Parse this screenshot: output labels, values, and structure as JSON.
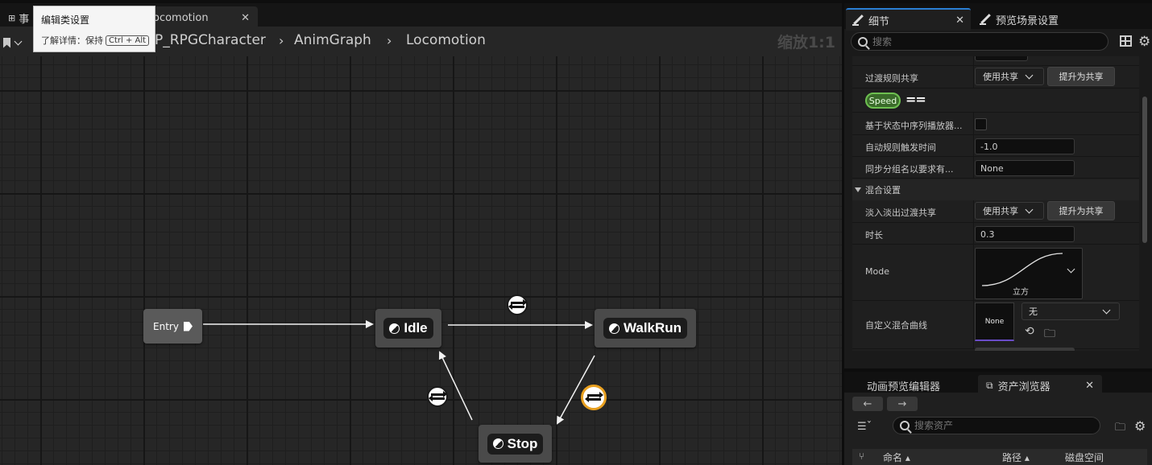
{
  "graph": {
    "tabs": {
      "events": "事",
      "locomotion": "ocomotion"
    },
    "breadcrumb": [
      "P_RPGCharacter",
      "AnimGraph",
      "Locomotion"
    ],
    "zoom": "缩放1:1",
    "tooltip": {
      "title": "编辑类设置",
      "desc": "了解详情：保持",
      "shortcut": "Ctrl + Alt"
    },
    "nodes": {
      "entry": "Entry",
      "idle": "Idle",
      "walkrun": "WalkRun",
      "stop": "Stop"
    }
  },
  "details": {
    "tab_details": "细节",
    "tab_preview": "预览场景设置",
    "search_placeholder": "搜索",
    "rows": {
      "transition_share_label": "过渡规则共享",
      "transition_share_value": "使用共享",
      "promote_label": "提升为共享",
      "speed_pill": "Speed",
      "eq": "==",
      "seq_player_label": "基于状态中序列播放器...",
      "auto_rule_label": "自动规则触发时间",
      "auto_rule_value": "-1.0",
      "sync_group_label": "同步分组名以要求有...",
      "sync_group_value": "None",
      "blend_section": "混合设置",
      "fade_share_label": "淡入淡出过渡共享",
      "fade_share_value": "使用共享",
      "promote2_label": "提升为共享",
      "duration_label": "时长",
      "duration_value": "0.3",
      "mode_label": "Mode",
      "mode_value": "立方",
      "curve_label": "自定义混合曲线",
      "curve_thumb": "None",
      "curve_value": "无"
    }
  },
  "dock": {
    "tab_anim_preview": "动画预览编辑器",
    "tab_assets": "资产浏览器",
    "search_placeholder": "搜索资产",
    "columns": [
      "命名",
      "路径",
      "磁盘空间"
    ]
  },
  "colors": {
    "accent": "#2a7fd4",
    "selected_transition": "#e8a020",
    "speed_pill": "#3a6b2a"
  }
}
